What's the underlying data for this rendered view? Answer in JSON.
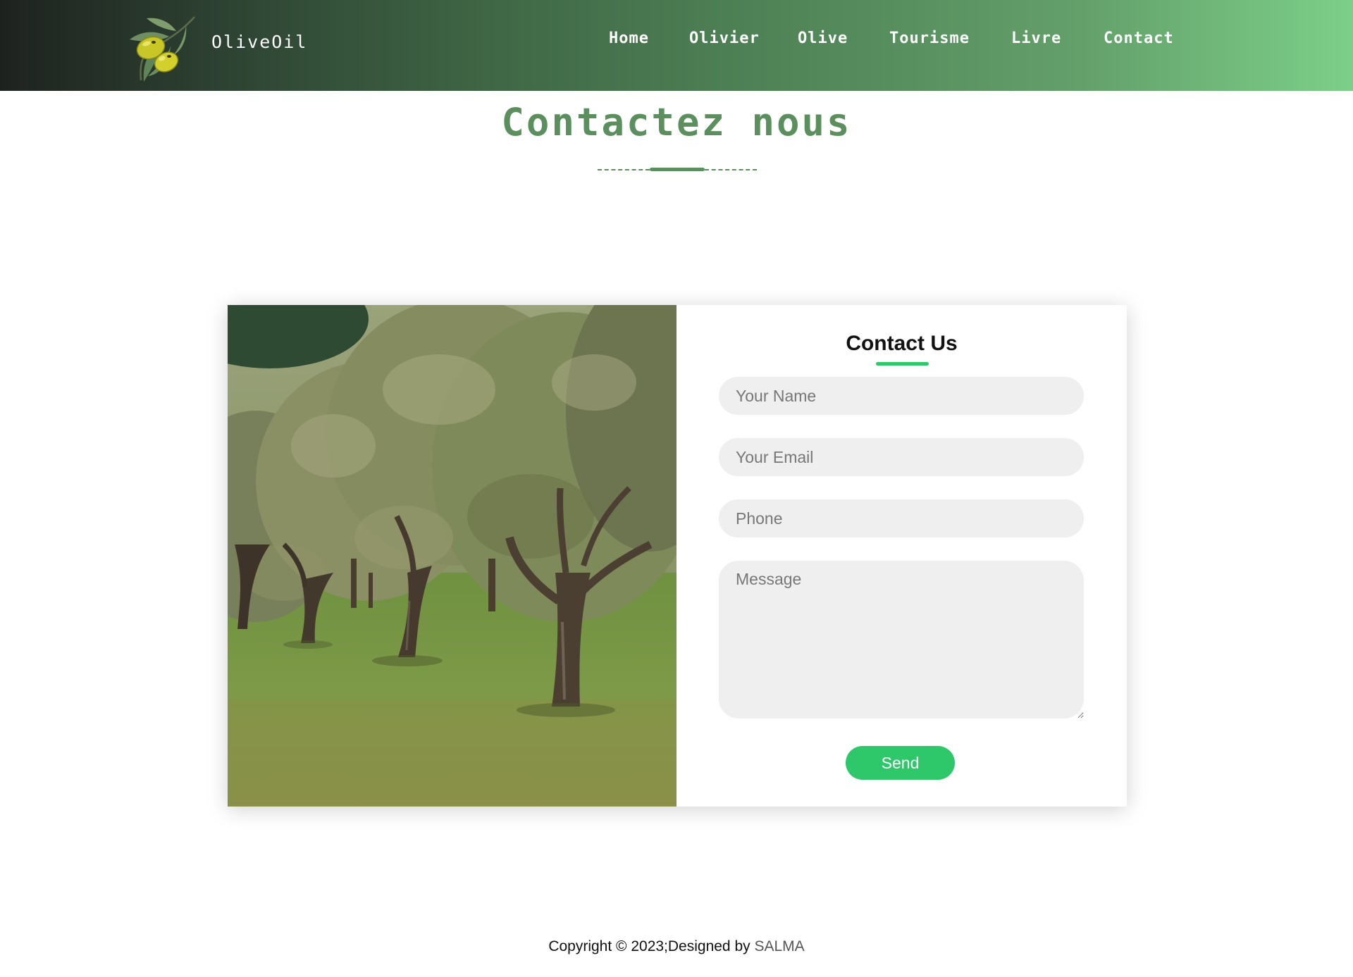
{
  "header": {
    "brand": "OliveOil",
    "nav": [
      "Home",
      "Olivier",
      "Olive",
      "Tourisme",
      "Livre",
      "Contact"
    ]
  },
  "section": {
    "title": "Contactez nous"
  },
  "contact_form": {
    "title": "Contact Us",
    "name_placeholder": "Your Name",
    "email_placeholder": "Your Email",
    "phone_placeholder": "Phone",
    "message_placeholder": "Message",
    "send_label": "Send"
  },
  "footer": {
    "copyright": "Copyright © 2023;Designed by ",
    "designer": "SALMA"
  },
  "colors": {
    "accent_green": "#2ec86a",
    "title_green": "#5c8f5e",
    "header_gradient_start": "#1e221f",
    "header_gradient_end": "#7ccf88"
  },
  "icons": {
    "logo": "olive-branch-icon"
  }
}
